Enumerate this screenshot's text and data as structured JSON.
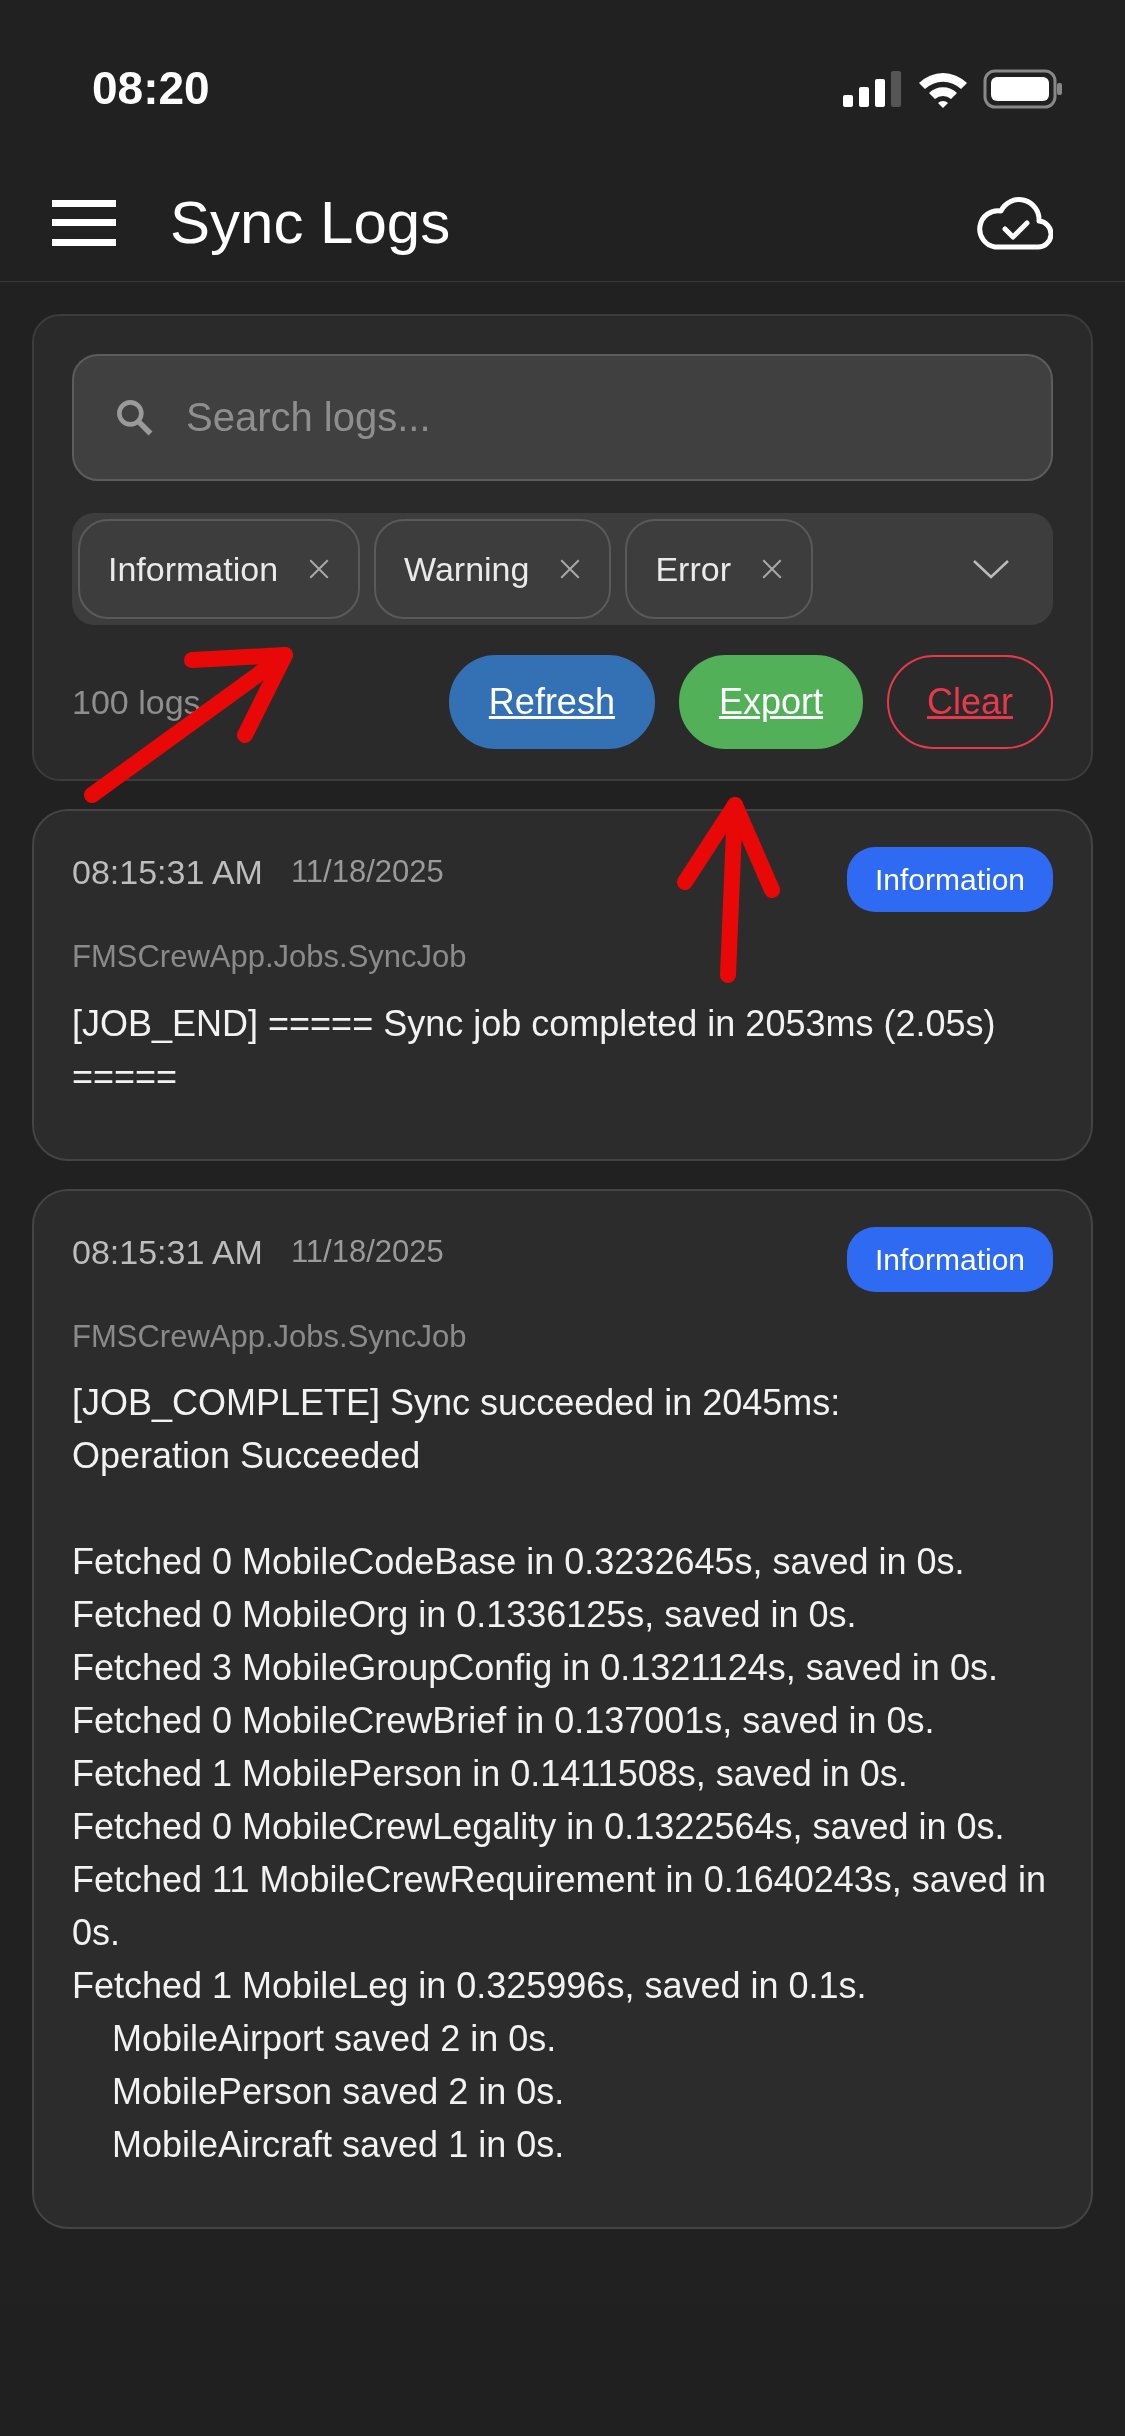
{
  "status_bar": {
    "time": "08:20"
  },
  "header": {
    "title": "Sync Logs"
  },
  "filters": {
    "search": {
      "placeholder": "Search logs..."
    },
    "levels": [
      {
        "label": "Information"
      },
      {
        "label": "Warning"
      },
      {
        "label": "Error"
      }
    ],
    "count": "100 logs",
    "buttons": [
      {
        "label": "Refresh",
        "kind": "primary"
      },
      {
        "label": "Export",
        "kind": "success"
      },
      {
        "label": "Clear",
        "kind": "danger"
      }
    ]
  },
  "logs": [
    {
      "time": "08:15:31 AM",
      "date": "11/18/2025",
      "level": "Information",
      "color": "#2f6bf2",
      "source": "FMSCrewApp.Jobs.SyncJob",
      "message": "[JOB_END] ===== Sync job completed in 2053ms (2.05s) ====="
    },
    {
      "time": "08:15:31 AM",
      "date": "11/18/2025",
      "level": "Information",
      "color": "#2f6bf2",
      "source": "FMSCrewApp.Jobs.SyncJob",
      "message": "[JOB_COMPLETE] Sync succeeded in 2045ms:\nOperation Succeeded\n\nFetched 0 MobileCodeBase in 0.3232645s, saved in 0s.\nFetched 0 MobileOrg in 0.1336125s, saved in 0s.\nFetched 3 MobileGroupConfig in 0.1321124s, saved in 0s.\nFetched 0 MobileCrewBrief in 0.137001s, saved in 0s.\nFetched 1 MobilePerson in 0.1411508s, saved in 0s.\nFetched 0 MobileCrewLegality in 0.1322564s, saved in 0s.\nFetched 11 MobileCrewRequirement in 0.1640243s, saved in 0s.\nFetched 1 MobileLeg in 0.325996s, saved in 0.1s.\n    MobileAirport saved 2 in 0s.\n    MobilePerson saved 2 in 0s.\n    MobileAircraft saved 1 in 0s."
    }
  ]
}
